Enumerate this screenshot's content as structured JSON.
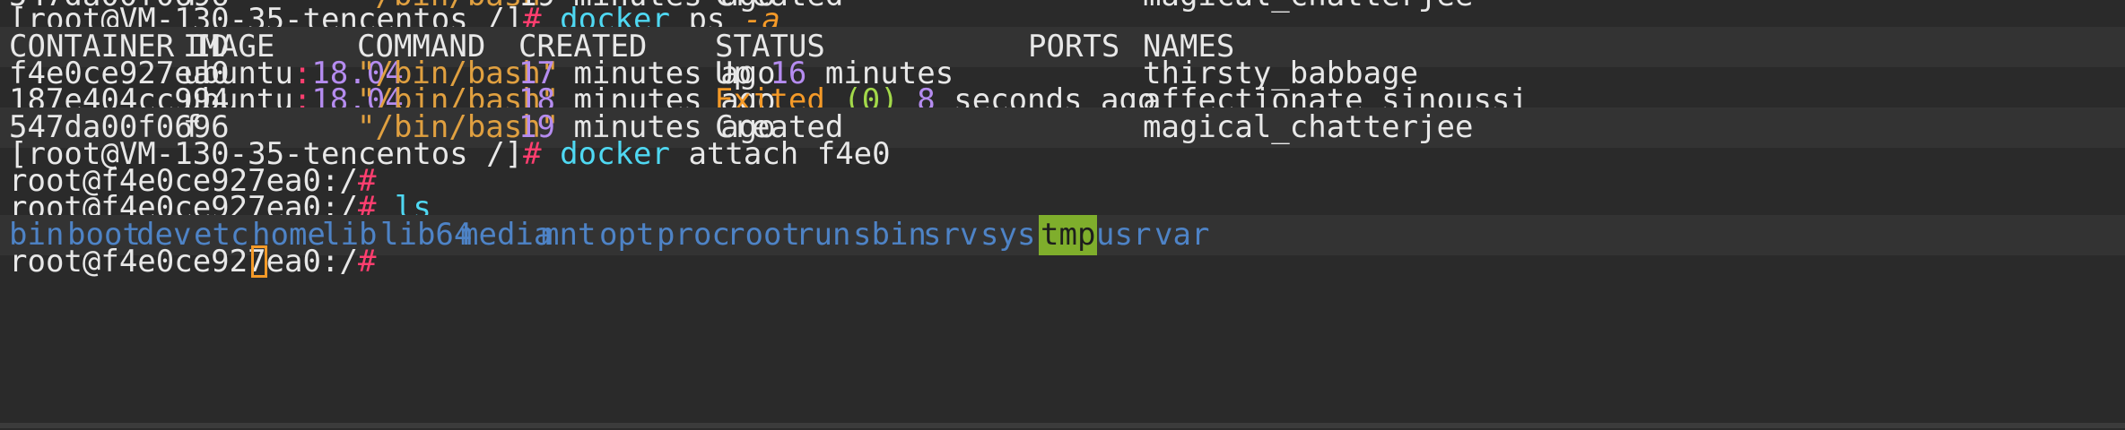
{
  "colors": {
    "background": "#2a2a2a",
    "text": "#e8e8e8",
    "prompt_hash": "#ff3e6f",
    "command": "#4fd8f2",
    "flag": "#f59a28",
    "number": "#b58cf0",
    "status_exited": "#e0a040",
    "paren_number": "#a3d94a",
    "dir": "#4e83c6",
    "highlight": "#7fae2c"
  },
  "prev_line_fragment": {
    "c1": "547da00f0696",
    "c2": "f",
    "c3": "\"/bin/bash\"",
    "c4": "19 minutes ago",
    "c5": "Created",
    "c6": "magical_chatterjee"
  },
  "prompt1": {
    "host": "[root@VM-130-35-tencentos /]",
    "hash": "#",
    "cmd": "docker",
    "args": "ps",
    "flag": "-a"
  },
  "header": {
    "container_id": "CONTAINER ID",
    "image": "IMAGE",
    "command": "COMMAND",
    "created": "CREATED",
    "status": "STATUS",
    "ports": "PORTS",
    "names": "NAMES"
  },
  "rows": [
    {
      "id": "f4e0ce927ea0",
      "image_name": "ubuntu",
      "image_sep": ":",
      "image_tag": "18.04",
      "command": "\"/bin/bash\"",
      "created_num": "17",
      "created_rest": "minutes ago",
      "status_a": "Up",
      "status_num": "16",
      "status_b": "minutes",
      "names": "thirsty_babbage"
    },
    {
      "id": "187e404cc994",
      "image_name": "ubuntu",
      "image_sep": ":",
      "image_tag": "18.04",
      "command": "\"/bin/bash\"",
      "created_num": "18",
      "created_rest": "minutes ago",
      "status_a": "Exited",
      "status_paren_open": "(",
      "status_code": "0",
      "status_paren_close": ")",
      "status_num": "8",
      "status_b": "seconds ago",
      "names": "affectionate_sinoussi"
    },
    {
      "id": "547da00f0696",
      "image_name": "f",
      "command": "\"/bin/bash\"",
      "created_num": "19",
      "created_rest": "minutes ago",
      "status_a": "Created",
      "names": "magical_chatterjee"
    }
  ],
  "prompt2": {
    "host": "[root@VM-130-35-tencentos /]",
    "hash": "#",
    "cmd": "docker",
    "args": "attach f4e0"
  },
  "container_prompt": {
    "host": "root@f4e0ce927ea0:/",
    "hash": "#"
  },
  "ls_cmd": "ls",
  "ls_dirs": [
    "bin",
    "boot",
    "dev",
    "etc",
    "home",
    "lib",
    "lib64",
    "media",
    "mnt",
    "opt",
    "proc",
    "root",
    "run",
    "sbin",
    "srv",
    "sys",
    "tmp",
    "usr",
    "var"
  ],
  "ls_highlight": "tmp"
}
